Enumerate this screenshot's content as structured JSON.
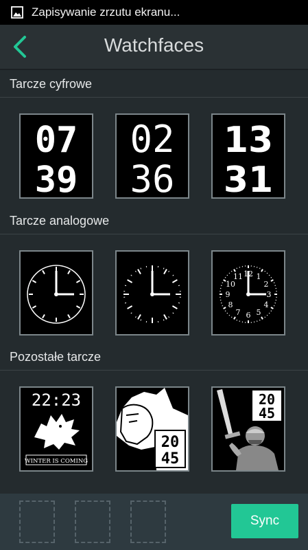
{
  "status_bar": {
    "notification_text": "Zapisywanie zrzutu ekranu...",
    "icon": "image-icon"
  },
  "app_bar": {
    "title": "Watchfaces",
    "back_icon": "back-arrow-icon"
  },
  "sections": [
    {
      "label": "Tarcze cyfrowe"
    },
    {
      "label": "Tarcze analogowe"
    },
    {
      "label": "Pozostałe tarcze"
    }
  ],
  "digital_faces": [
    {
      "top": "07",
      "bottom": "39"
    },
    {
      "top": "02",
      "bottom": "36"
    },
    {
      "top": "13",
      "bottom": "31"
    }
  ],
  "other_faces": [
    {
      "time": "22:23",
      "caption": "WINTER IS COMING"
    },
    {
      "time_top": "20",
      "time_bottom": "45"
    },
    {
      "time_top": "20",
      "time_bottom": "45"
    }
  ],
  "clock_numbers": [
    "12",
    "1",
    "2",
    "3",
    "4",
    "5",
    "6",
    "7",
    "8",
    "9",
    "10",
    "11"
  ],
  "bottom_bar": {
    "sync_label": "Sync"
  },
  "colors": {
    "accent": "#22c795",
    "background": "#242b2e",
    "statusbar": "#000000"
  }
}
